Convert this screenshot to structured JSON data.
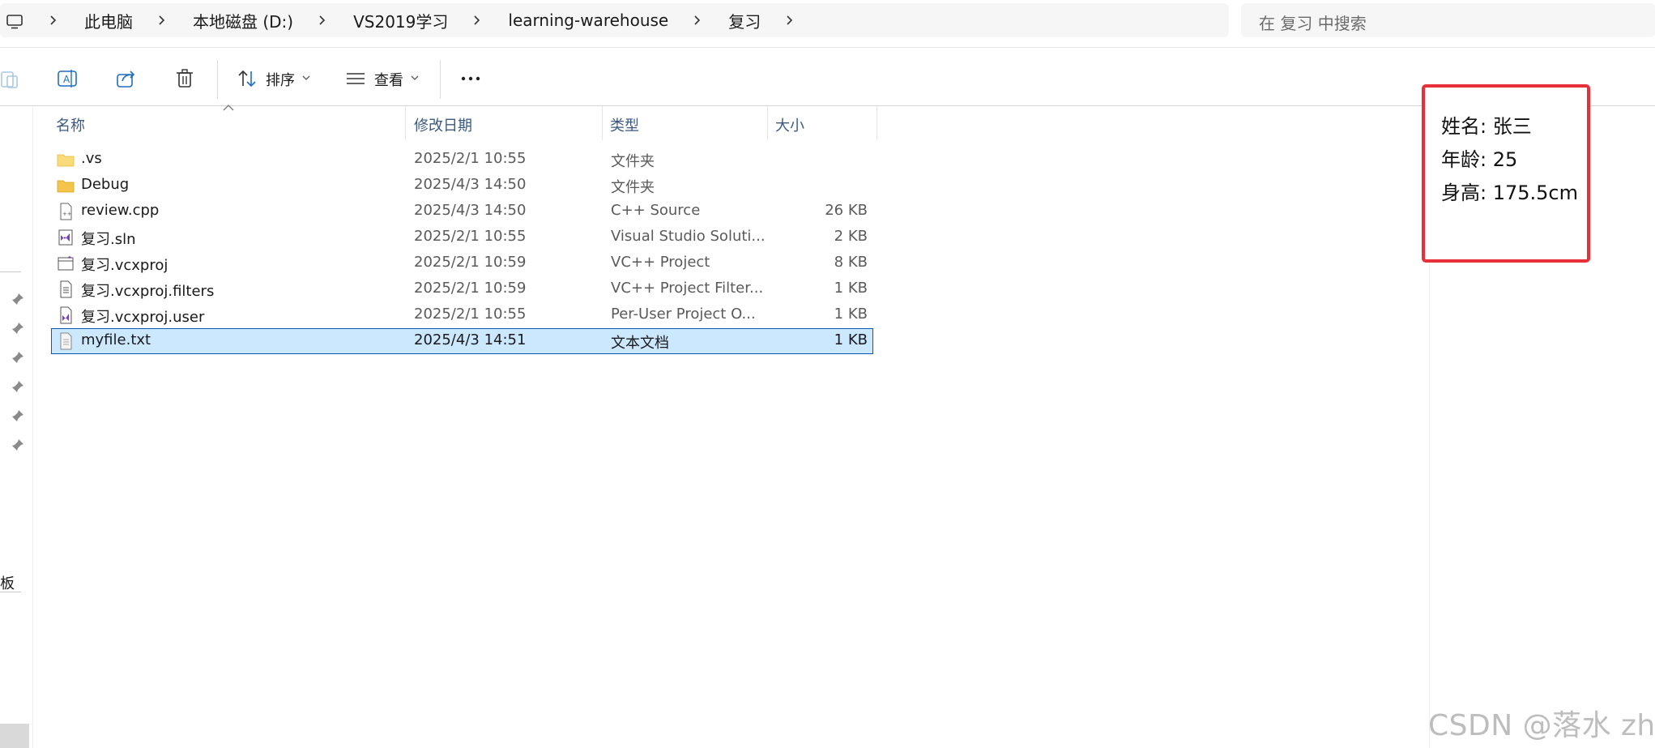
{
  "breadcrumb": {
    "items": [
      "此电脑",
      "本地磁盘 (D:)",
      "VS2019学习",
      "learning-warehouse",
      "复习"
    ]
  },
  "search": {
    "placeholder": "在 复习 中搜索"
  },
  "toolbar": {
    "sort_label": "排序",
    "view_label": "查看"
  },
  "nav": {
    "partial_text": "板"
  },
  "list": {
    "columns": {
      "name": "名称",
      "date": "修改日期",
      "type": "类型",
      "size": "大小"
    },
    "rows": [
      {
        "icon": "folder-icon",
        "name": ".vs",
        "date": "2025/2/1 10:55",
        "type": "文件夹",
        "size": ""
      },
      {
        "icon": "folder-icon",
        "name": "Debug",
        "date": "2025/4/3 14:50",
        "type": "文件夹",
        "size": ""
      },
      {
        "icon": "cpp-file-icon",
        "name": "review.cpp",
        "date": "2025/4/3 14:50",
        "type": "C++ Source",
        "size": "26 KB"
      },
      {
        "icon": "sln-file-icon",
        "name": "复习.sln",
        "date": "2025/2/1 10:55",
        "type": "Visual Studio Soluti...",
        "size": "2 KB"
      },
      {
        "icon": "vcxproj-file-icon",
        "name": "复习.vcxproj",
        "date": "2025/2/1 10:59",
        "type": "VC++ Project",
        "size": "8 KB"
      },
      {
        "icon": "filters-file-icon",
        "name": "复习.vcxproj.filters",
        "date": "2025/2/1 10:59",
        "type": "VC++ Project Filter...",
        "size": "1 KB"
      },
      {
        "icon": "user-file-icon",
        "name": "复习.vcxproj.user",
        "date": "2025/2/1 10:55",
        "type": "Per-User Project O...",
        "size": "1 KB"
      },
      {
        "icon": "text-file-icon",
        "name": "myfile.txt",
        "date": "2025/4/3 14:51",
        "type": "文本文档",
        "size": "1 KB",
        "selected": true
      }
    ]
  },
  "preview": {
    "lines": [
      "姓名: 张三",
      "年龄: 25",
      "身高: 175.5cm"
    ]
  },
  "watermark": "CSDN @落水 zh",
  "colors": {
    "selection_bg": "#cce8ff",
    "selection_border": "#0a58b5",
    "highlight_box": "#e8303a",
    "folder": "#f5c44a"
  }
}
